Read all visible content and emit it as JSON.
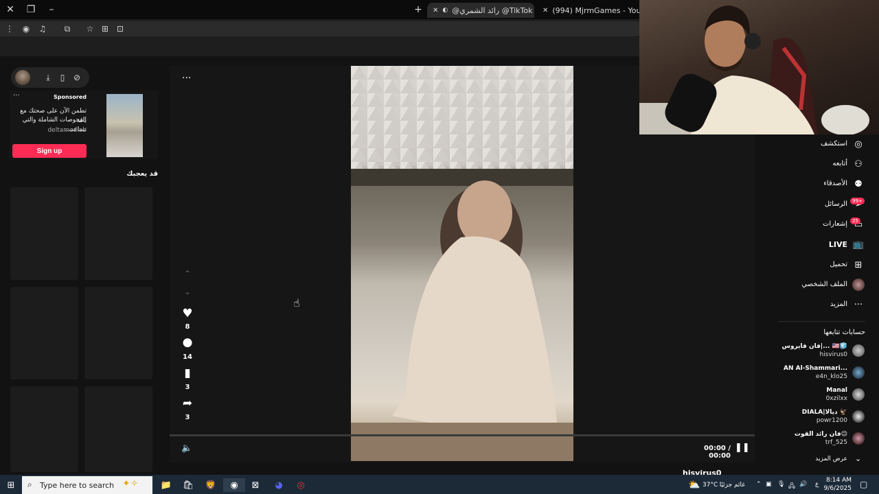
{
  "browser": {
    "tabs": [
      {
        "title": "| TikTok@ رائد الشمري@",
        "active": true
      },
      {
        "title": "(994) MjrmGames - YouTube",
        "active": false
      }
    ],
    "new_tab_symbol": "+",
    "window_controls": {
      "close": "✕",
      "restore": "❐",
      "minimize": "–"
    }
  },
  "left_panel": {
    "ad": {
      "sponsored_label": "Sponsored",
      "menu": "···",
      "text_line1": "تطمن الآن على صحتك مع باقة",
      "text_line2": "الفحوصات الشاملة والتي تساعد...",
      "advertiser": "deltamedlab",
      "cta": "Sign up"
    },
    "section_title": "قد يعجبك"
  },
  "video": {
    "more_menu": "···",
    "likes": "8",
    "comments": "14",
    "saves": "3",
    "shares": "3",
    "time": "00:00 / 00:00",
    "author_peek": "hisvirus0"
  },
  "right_nav": {
    "items": [
      {
        "label": "استكشف",
        "icon": "compass-icon"
      },
      {
        "label": "أتابعه",
        "icon": "add-person-icon"
      },
      {
        "label": "الأصدقاء",
        "icon": "friends-icon"
      },
      {
        "label": "الرسائل",
        "icon": "messages-icon",
        "badge": "99+"
      },
      {
        "label": "إشعارات",
        "icon": "inbox-icon",
        "badge": "25"
      },
      {
        "label": "LIVE",
        "icon": "live-tv-icon"
      },
      {
        "label": "تحميل",
        "icon": "upload-icon"
      },
      {
        "label": "الملف الشخصي",
        "icon": "profile-avatar-icon"
      },
      {
        "label": "المزيد",
        "icon": "more-dots-icon"
      }
    ],
    "following_title": "حسابات تتابعها",
    "following": [
      {
        "name": "فان فايروس|... 🇺🇸🧊",
        "handle": "hisvirus0"
      },
      {
        "name": "AN Al-Shammari...",
        "handle": "e4n_klo25"
      },
      {
        "name": "Manal",
        "handle": "0xzilxx"
      },
      {
        "name": "DIALA|ديالا 🦅",
        "handle": "powr1200"
      },
      {
        "name": "فان رائد القوت😉",
        "handle": "trf_525"
      }
    ],
    "see_more": "عرض المزيد"
  },
  "taskbar": {
    "search_placeholder": "Type here to search",
    "weather_temp": "37°C",
    "weather_desc": "غائم جزئيًا",
    "lang": "ع",
    "time": "8:14 AM",
    "date": "9/6/2025"
  },
  "colors": {
    "accent": "#fe2c55",
    "background": "#121212"
  }
}
